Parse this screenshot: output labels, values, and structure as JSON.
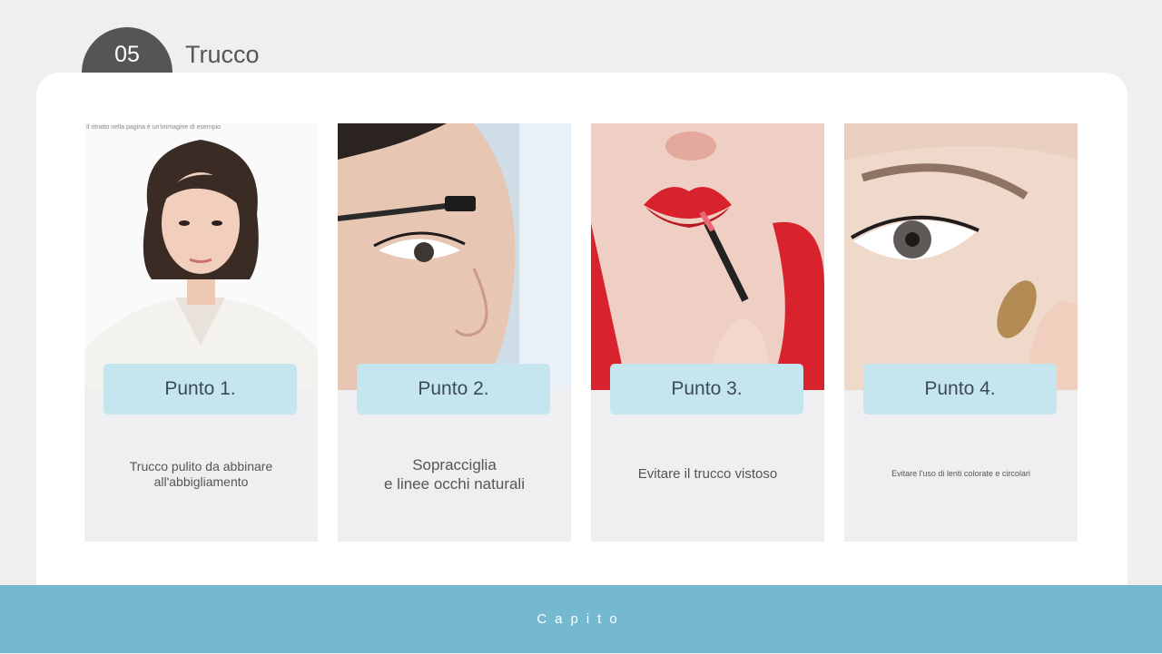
{
  "header": {
    "section_number": "05",
    "section_title": "Trucco"
  },
  "cards": [
    {
      "label": "Punto 1.",
      "text": "Trucco pulito da abbinare all'abbigliamento",
      "photo_note": "Il ritratto nella pagina è un'immagine di esempio"
    },
    {
      "label": "Punto 2.",
      "text_lines": [
        "Sopracciglia",
        "e linee occhi naturali"
      ]
    },
    {
      "label": "Punto 3.",
      "text": "Evitare il trucco vistoso"
    },
    {
      "label": "Punto 4.",
      "text": "Evitare l'uso di lenti colorate e circolari"
    }
  ],
  "footer": {
    "button_label": "Capito"
  },
  "colors": {
    "accent": "#74b9d0",
    "label_bg": "#c6e6ef",
    "badge": "#555555",
    "lipstick": "#d8232e"
  }
}
